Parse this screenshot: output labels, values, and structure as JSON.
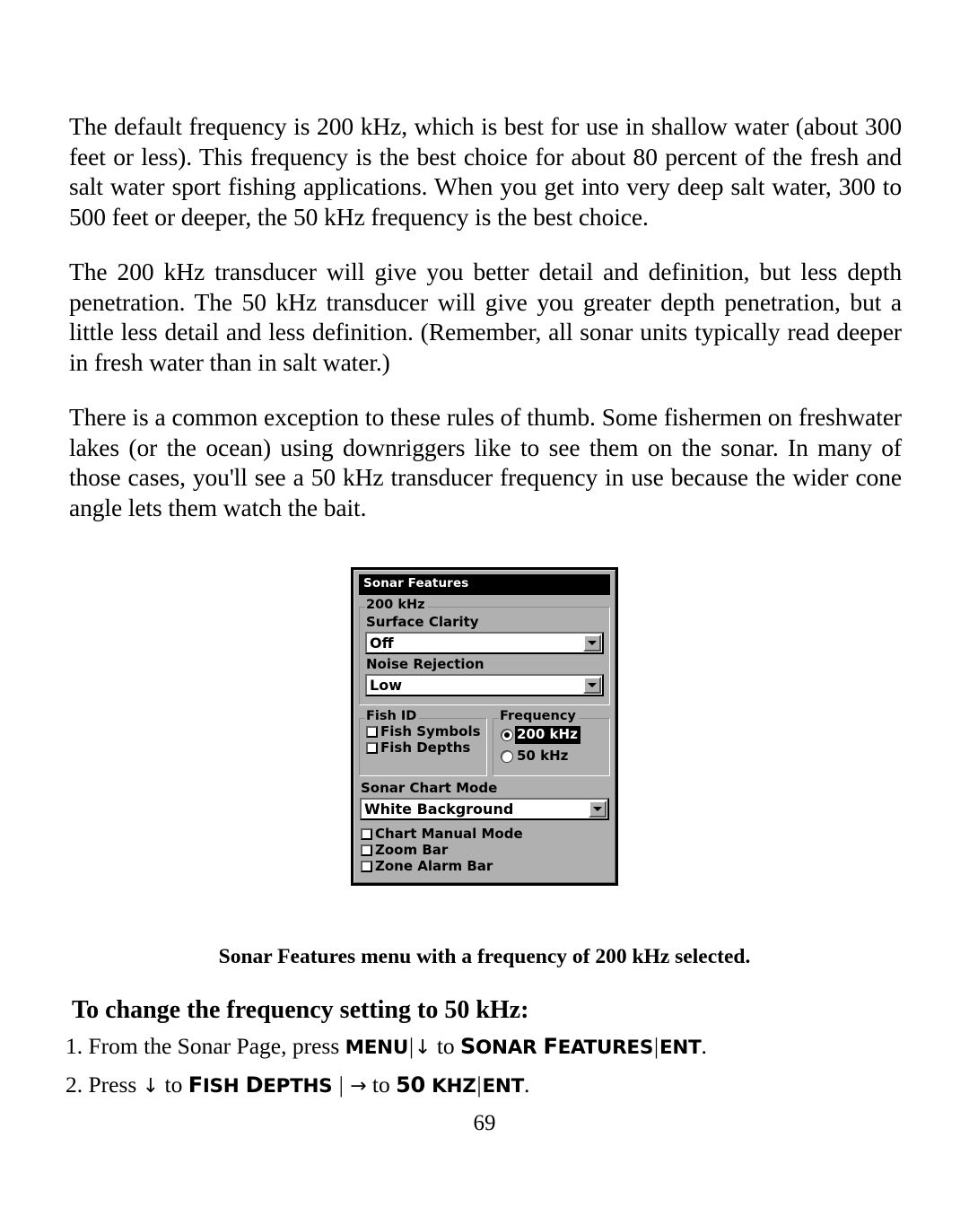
{
  "document": {
    "page_number": "69",
    "paragraphs": [
      "The default frequency is 200 kHz, which is best for use in shallow water (about 300 feet or less). This frequency is the best choice for about 80 percent of the fresh and salt water sport fishing applications. When you get into very deep salt water, 300 to 500 feet or deeper, the 50 kHz frequency is the best choice.",
      "The 200 kHz transducer will give you better detail and definition, but less depth penetration. The 50 kHz transducer will give you greater depth penetration, but a little less detail and less definition. (Remember, all sonar units typically read deeper in fresh water than in salt water.)",
      "There is a common exception to these rules of thumb. Some fishermen on freshwater lakes (or the ocean) using downriggers like to see them on the sonar. In many of those cases, you'll see a 50 kHz transducer frequency in use because the wider cone angle lets them watch the bait."
    ],
    "figure_caption": "Sonar Features menu with a frequency of 200 kHz selected.",
    "subheading": "To change the frequency setting to 50 kHz:",
    "steps": [
      {
        "number": "1.",
        "text_before": "From the Sonar Page, press",
        "key1": "MENU",
        "sep1": "|",
        "arrow": "↓",
        "text_mid": "to",
        "smallcaps_first": "S",
        "smallcaps_rest": "ONAR",
        "smallcaps_first2": "F",
        "smallcaps_rest2": "EATURES",
        "sep2": "|",
        "key2": "ENT",
        "period": "."
      },
      {
        "number": "2.",
        "text_before": "Press",
        "arrow1": "↓",
        "text_mid": "to",
        "smallcaps_first": "F",
        "smallcaps_rest": "ISH",
        "smallcaps_first2": "D",
        "smallcaps_rest2": "EPTHS",
        "sep1": "|",
        "arrow2": "→",
        "text_mid2": "to",
        "key_num": "50",
        "key_unit": "KHZ",
        "sep2": "|",
        "key2": "ENT",
        "period": "."
      }
    ]
  },
  "dialog": {
    "title": "Sonar Features",
    "frequency_group_200": {
      "legend": "200 kHz",
      "surface_clarity_label": "Surface Clarity",
      "surface_clarity_value": "Off",
      "noise_rejection_label": "Noise Rejection",
      "noise_rejection_value": "Low"
    },
    "fish_id": {
      "legend": "Fish ID",
      "items": [
        {
          "label": "Fish Symbols",
          "checked": false
        },
        {
          "label": "Fish Depths",
          "checked": false
        }
      ]
    },
    "frequency": {
      "legend": "Frequency",
      "options": [
        {
          "label": "200 kHz",
          "selected": true
        },
        {
          "label": "50 kHz",
          "selected": false
        }
      ]
    },
    "sonar_chart_mode": {
      "label": "Sonar Chart Mode",
      "value": "White Background"
    },
    "toggles": [
      {
        "label": "Chart Manual Mode",
        "checked": false
      },
      {
        "label": "Zoom Bar",
        "checked": false
      },
      {
        "label": "Zone Alarm Bar",
        "checked": false
      }
    ],
    "colors": {
      "dialog_background": "#b0b0b0",
      "titlebar_background": "#000000",
      "titlebar_text": "#ffffff",
      "field_background": "#ffffff",
      "selection_background": "#000000",
      "selection_text": "#ffffff"
    }
  }
}
